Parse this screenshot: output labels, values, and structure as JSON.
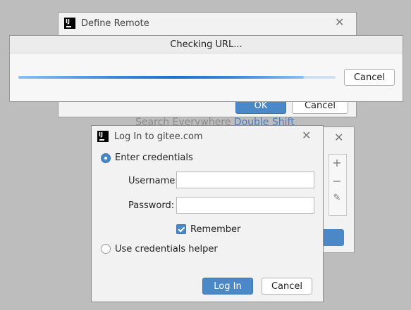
{
  "define_remote": {
    "title": "Define Remote",
    "ok_label": "OK",
    "cancel_label": "Cancel"
  },
  "checking_url": {
    "title": "Checking URL...",
    "cancel_label": "Cancel",
    "progress": 0.9
  },
  "background": {
    "search_prefix": "Search Everywhere",
    "search_shortcut": "Double Shift"
  },
  "login": {
    "title": "Log In to gitee.com",
    "option_credentials": "Enter credentials",
    "username_label": "Username:",
    "password_label": "Password:",
    "username_value": "",
    "password_value": "",
    "remember_label": "Remember",
    "option_helper": "Use credentials helper",
    "login_label": "Log In",
    "cancel_label": "Cancel"
  },
  "colors": {
    "accent": "#4a88c7",
    "background": "#bdbdbd"
  }
}
